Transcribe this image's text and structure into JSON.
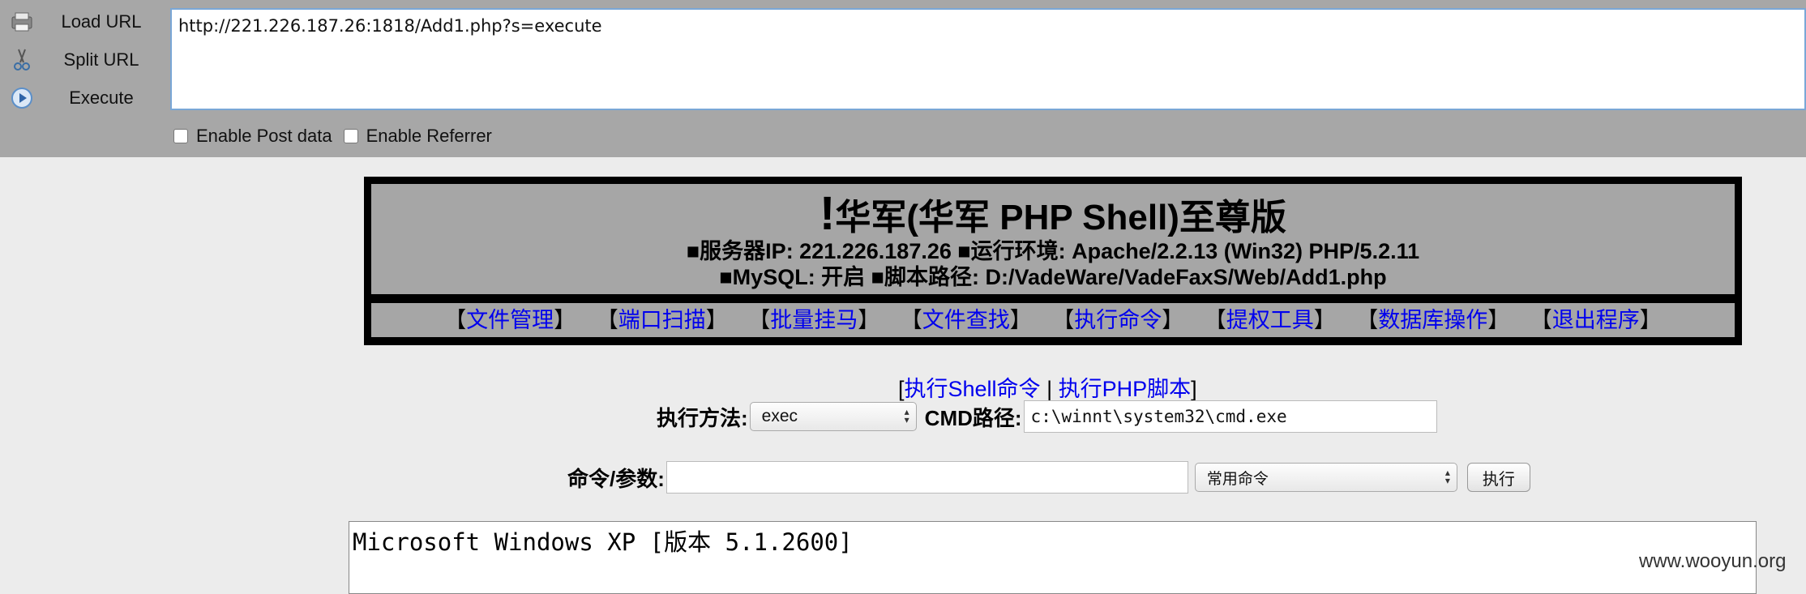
{
  "hackbar": {
    "buttons": [
      {
        "label": "Load URL",
        "icon": "load-url-icon"
      },
      {
        "label": "Split URL",
        "icon": "scissors-icon"
      },
      {
        "label": "Execute",
        "icon": "play-icon"
      }
    ],
    "url": "http://221.226.187.26:1818/Add1.php?s=execute",
    "options": {
      "post_label": "Enable Post data",
      "referrer_label": "Enable Referrer"
    }
  },
  "shell": {
    "title_mark": "!",
    "title": "华军(华军 PHP Shell)至尊版",
    "info_line1": "■服务器IP: 221.226.187.26 ■运行环境: Apache/2.2.13 (Win32) PHP/5.2.11",
    "info_line2": "■MySQL: 开启 ■脚本路径: D:/VadeWare/VadeFaxS/Web/Add1.php",
    "nav": [
      "文件管理",
      "端口扫描",
      "批量挂马",
      "文件查找",
      "执行命令",
      "提权工具",
      "数据库操作",
      "退出程序"
    ]
  },
  "exec": {
    "link_shell": "执行Shell命令",
    "separator": "|",
    "link_php": "执行PHP脚本",
    "method_label": "执行方法:",
    "method_value": "exec",
    "cmd_path_label": "CMD路径:",
    "cmd_path_value": "c:\\winnt\\system32\\cmd.exe",
    "args_label": "命令/参数:",
    "args_value": "",
    "common_select": "常用命令",
    "run_button": "执行"
  },
  "output": "Microsoft Windows XP [版本 5.1.2600]",
  "watermark": "www.wooyun.org",
  "colors": {
    "link": "#0000ee",
    "panel": "#a6a6a6",
    "toolbar": "#a7a7a7"
  }
}
